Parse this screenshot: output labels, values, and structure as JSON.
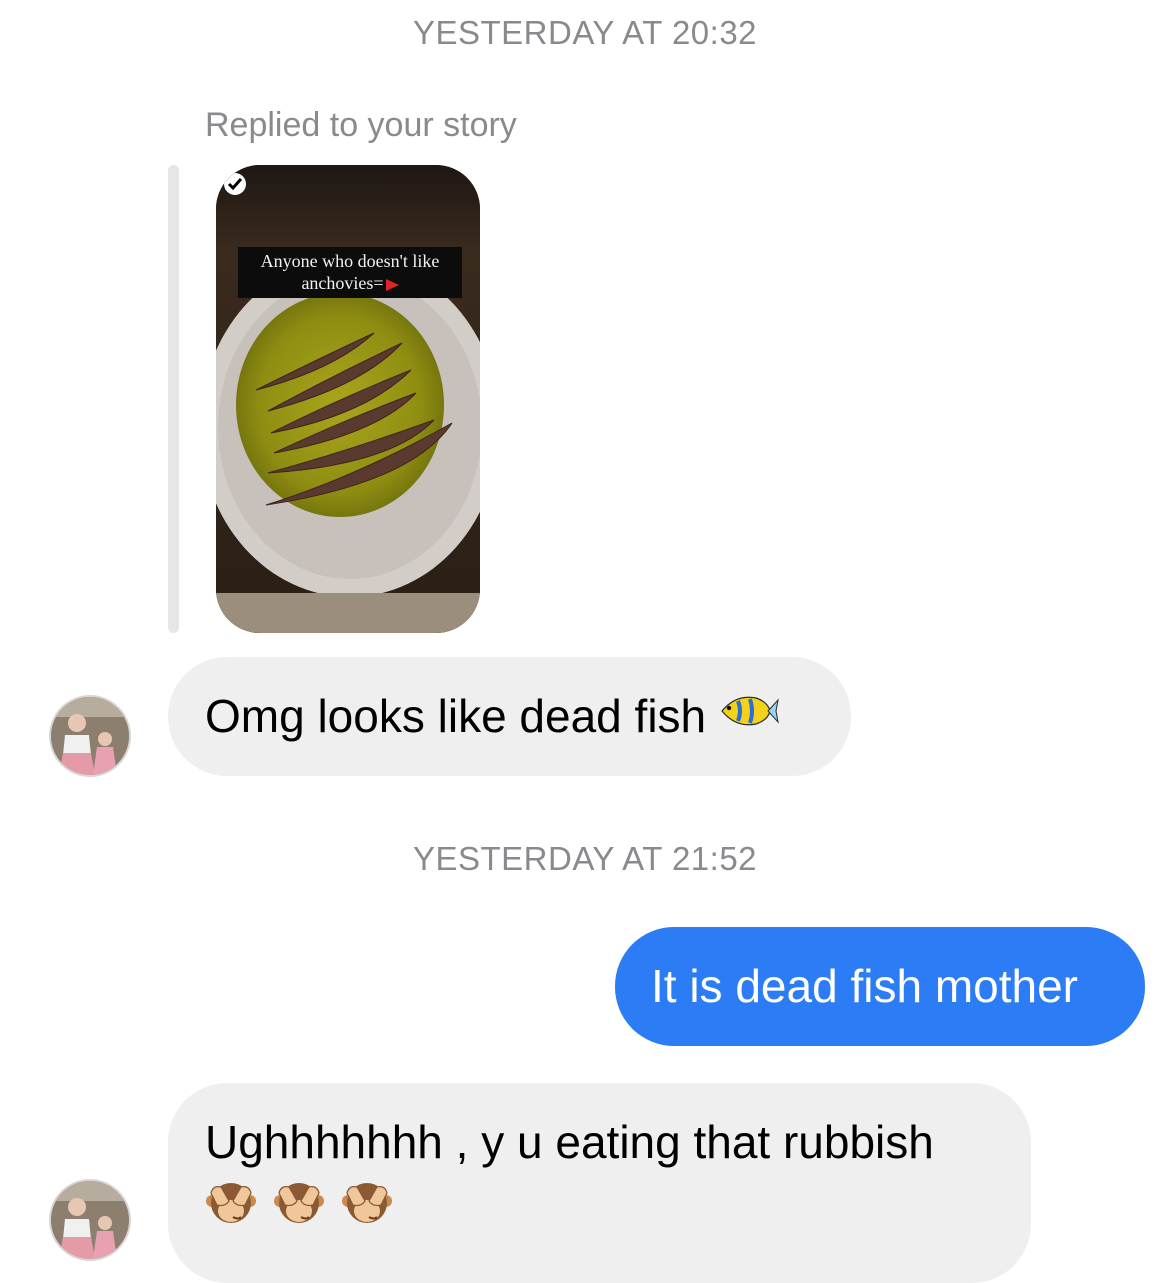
{
  "conversation": {
    "timestamps": [
      "YESTERDAY AT 20:32",
      "YESTERDAY AT 21:52"
    ],
    "story_reply": {
      "label": "Replied to your story",
      "story_caption_line1": "Anyone who doesn't like",
      "story_caption_line2": "anchovies="
    },
    "messages": [
      {
        "direction": "incoming",
        "text": "Omg looks like dead fish",
        "emoji": "tropical-fish-icon"
      },
      {
        "direction": "outgoing",
        "text": "It is dead fish mother"
      },
      {
        "direction": "incoming",
        "text": "Ughhhhhhh , y u eating that rubbish",
        "emoji": "see-no-evil-monkey-icon",
        "emoji_count": 3
      }
    ]
  },
  "colors": {
    "outgoing_bubble": "#2b7cf5",
    "incoming_bubble": "#efeff0",
    "meta_text": "#8a8a8e"
  }
}
